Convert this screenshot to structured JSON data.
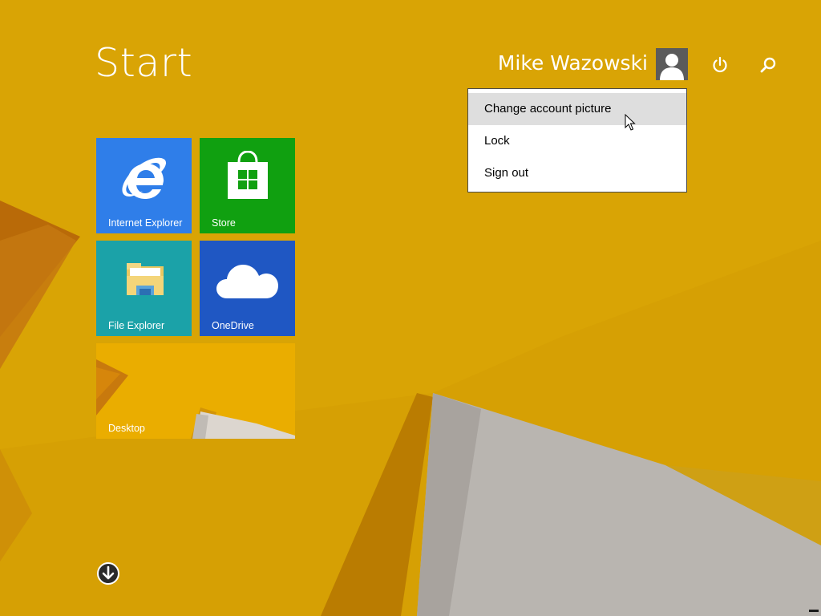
{
  "start_screen": {
    "title": "Start"
  },
  "account": {
    "user_name": "Mike Wazowski",
    "avatar_icon": "user-avatar-icon",
    "menu": {
      "items": [
        {
          "label": "Change account picture",
          "hovered": true
        },
        {
          "label": "Lock",
          "hovered": false
        },
        {
          "label": "Sign out",
          "hovered": false
        }
      ]
    }
  },
  "header_buttons": {
    "power_icon": "power-icon",
    "search_icon": "search-icon"
  },
  "tiles": [
    {
      "label": "Internet Explorer",
      "icon": "internet-explorer-icon",
      "color": "#2b7be8"
    },
    {
      "label": "Store",
      "icon": "store-icon",
      "color": "#12a312"
    },
    {
      "label": "File Explorer",
      "icon": "file-explorer-icon",
      "color": "#1ba1a8"
    },
    {
      "label": "OneDrive",
      "icon": "onedrive-icon",
      "color": "#1e56c2"
    },
    {
      "label": "Desktop",
      "icon": "desktop-wallpaper-thumbnail",
      "color": "#e5a500"
    }
  ],
  "all_apps": {
    "icon": "down-arrow-circle-icon"
  },
  "colors": {
    "wallpaper_base": "#d9a002",
    "wallpaper_dark": "#b86b00",
    "wallpaper_light": "#c4c0bb"
  }
}
